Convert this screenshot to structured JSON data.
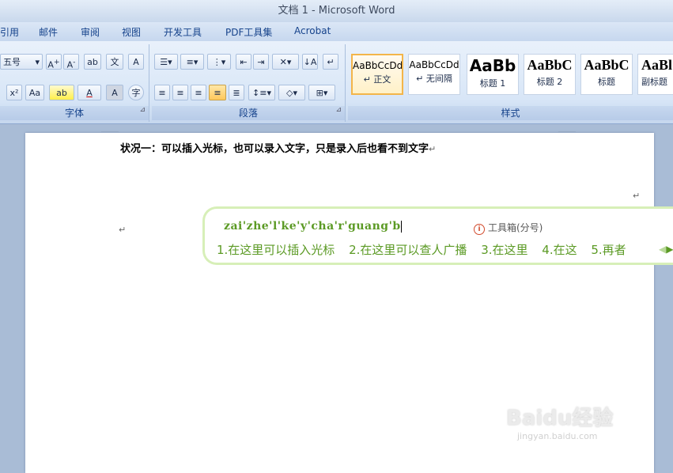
{
  "window": {
    "title": "文档 1 - Microsoft Word"
  },
  "tabs": [
    "引用",
    "邮件",
    "审阅",
    "视图",
    "开发工具",
    "PDF工具集",
    "Acrobat"
  ],
  "ribbon": {
    "font_group": {
      "label": "字体",
      "font_size": "五号",
      "aa_label": "Aa",
      "x2_label": "x²"
    },
    "paragraph_group": {
      "label": "段落"
    },
    "styles_group": {
      "label": "样式",
      "styles": [
        {
          "sample": "AaBbCcDd",
          "name": "↵ 正文"
        },
        {
          "sample": "AaBbCcDd",
          "name": "↵ 无间隔"
        },
        {
          "sample": "AaBb",
          "name": "标题 1"
        },
        {
          "sample": "AaBbC",
          "name": "标题 2"
        },
        {
          "sample": "AaBbC",
          "name": "标题"
        },
        {
          "sample": "AaBl",
          "name": "副标题"
        }
      ]
    }
  },
  "document": {
    "line1": "状况一：可以插入光标，也可以录入文字，只是录入后也看不到文字",
    "para_mark": "↵"
  },
  "ime": {
    "pinyin": "zai'zhe'l'ke'y'cha'r'guang'b",
    "tools": "工具箱(分号)",
    "info_icon": "i",
    "candidates": [
      "1.在这里可以插入光标",
      "2.在这里可以查人广播",
      "3.在这里",
      "4.在这",
      "5.再者"
    ]
  },
  "watermark": {
    "main": "Baidu经验",
    "sub": "jingyan.baidu.com"
  }
}
